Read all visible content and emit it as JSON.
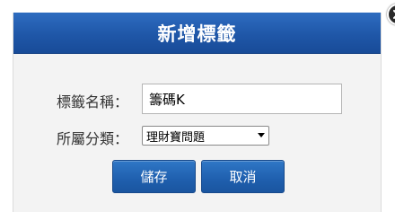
{
  "dialog": {
    "title": "新增標籤",
    "fields": {
      "name_label": "標籤名稱：",
      "name_value": "籌碼K",
      "category_label": "所屬分類：",
      "category_selected": "理財寶問題"
    },
    "buttons": {
      "save_label": "儲存",
      "cancel_label": "取消"
    },
    "icons": {
      "close": "close-icon",
      "dropdown": "chevron-down-icon"
    }
  },
  "colors": {
    "title_bar": "#1f57a8",
    "button": "#1f5fae",
    "panel_bg": "#f3f3f3"
  }
}
